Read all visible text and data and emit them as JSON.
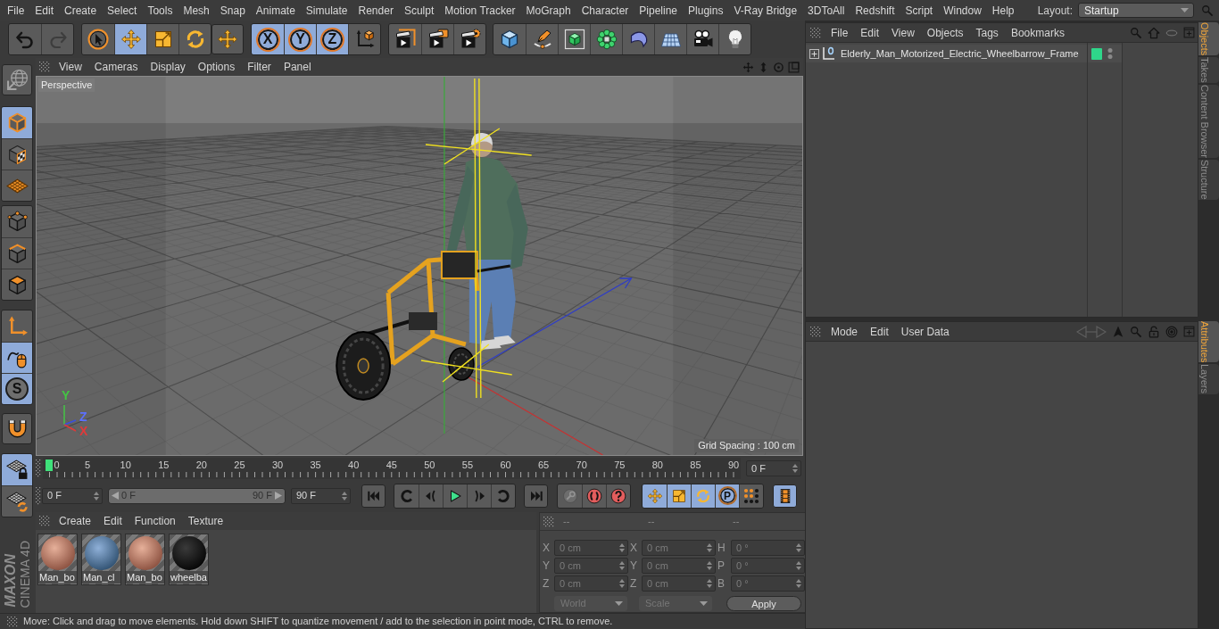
{
  "menu_bar": {
    "items": [
      "File",
      "Edit",
      "Create",
      "Select",
      "Tools",
      "Mesh",
      "Snap",
      "Animate",
      "Simulate",
      "Render",
      "Sculpt",
      "Motion Tracker",
      "MoGraph",
      "Character",
      "Pipeline",
      "Plugins",
      "V-Ray Bridge",
      "3DToAll",
      "Redshift",
      "Script",
      "Window",
      "Help"
    ],
    "layout_label": "Layout:",
    "layout_value": "Startup"
  },
  "toolbar": {
    "groups": [
      [
        {
          "kind": "icon",
          "selected": false,
          "disabled": false
        },
        {
          "kind": "icon",
          "selected": false,
          "disabled": true
        }
      ],
      [
        {
          "kind": "icon",
          "selected": false,
          "disabled": false
        },
        {
          "kind": "icon",
          "selected": true,
          "disabled": false
        },
        {
          "kind": "icon",
          "selected": false,
          "disabled": false
        },
        {
          "kind": "icon",
          "selected": false,
          "disabled": false
        }
      ],
      [
        {
          "kind": "icon",
          "selected": false,
          "disabled": false
        }
      ],
      [
        {
          "kind": "letter",
          "label": "X",
          "selected": true,
          "disabled": false
        },
        {
          "kind": "letter",
          "label": "Y",
          "selected": true,
          "disabled": false
        },
        {
          "kind": "letter",
          "label": "Z",
          "selected": true,
          "disabled": false
        },
        {
          "kind": "icon",
          "selected": false,
          "disabled": false
        }
      ],
      [
        {
          "kind": "icon",
          "selected": false,
          "disabled": false
        },
        {
          "kind": "icon",
          "selected": false,
          "disabled": false
        },
        {
          "kind": "icon",
          "selected": false,
          "disabled": false
        }
      ],
      [
        {
          "kind": "icon",
          "selected": false,
          "disabled": false
        },
        {
          "kind": "icon",
          "selected": false,
          "disabled": false
        },
        {
          "kind": "icon",
          "selected": false,
          "disabled": false
        },
        {
          "kind": "icon",
          "selected": false,
          "disabled": false
        },
        {
          "kind": "icon",
          "selected": false,
          "disabled": false
        },
        {
          "kind": "icon",
          "selected": false,
          "disabled": false
        },
        {
          "kind": "icon",
          "selected": false,
          "disabled": false
        },
        {
          "kind": "icon",
          "selected": false,
          "disabled": false
        }
      ]
    ]
  },
  "object_manager": {
    "menu": [
      "File",
      "Edit",
      "View",
      "Objects",
      "Tags",
      "Bookmarks"
    ],
    "objects": [
      {
        "name": "Elderly_Man_Motorized_Electric_Wheelbarrow_Frame",
        "expanded": false
      }
    ]
  },
  "side_tabs": {
    "upper": [
      {
        "label": "Objects",
        "selected": true
      },
      {
        "label": "Takes",
        "selected": false
      },
      {
        "label": "Content Browser",
        "selected": false
      },
      {
        "label": "Structure",
        "selected": false
      }
    ],
    "lower": [
      {
        "label": "Attributes",
        "selected": true
      },
      {
        "label": "Layers",
        "selected": false
      }
    ]
  },
  "mode_palette": {
    "groups": [
      [
        {
          "kind": "icon",
          "selected": false
        }
      ],
      [
        {
          "kind": "icon",
          "selected": true
        },
        {
          "kind": "icon",
          "selected": false
        },
        {
          "kind": "icon",
          "selected": false
        }
      ],
      [
        {
          "kind": "icon",
          "selected": false
        },
        {
          "kind": "icon",
          "selected": false
        },
        {
          "kind": "icon",
          "selected": false
        }
      ],
      [
        {
          "kind": "icon",
          "selected": false
        },
        {
          "kind": "icon",
          "selected": true
        },
        {
          "kind": "letter",
          "label": "S",
          "selected": true
        }
      ],
      [
        {
          "kind": "icon",
          "selected": false
        }
      ],
      [
        {
          "kind": "icon",
          "selected": true
        },
        {
          "kind": "icon",
          "selected": false
        }
      ]
    ]
  },
  "viewport": {
    "menu": [
      "View",
      "Cameras",
      "Display",
      "Options",
      "Filter",
      "Panel"
    ],
    "camera": "Perspective",
    "axis_labels": [
      {
        "label": "Y",
        "color": "#44c444"
      },
      {
        "label": "Z",
        "color": "#5c70ff"
      },
      {
        "label": "X",
        "color": "#e03a3a"
      }
    ],
    "grid_spacing": "Grid Spacing : 100 cm"
  },
  "attribute_manager": {
    "menu": [
      "Mode",
      "Edit",
      "User Data"
    ]
  },
  "timeline": {
    "frames": [
      "0",
      "5",
      "10",
      "15",
      "20",
      "25",
      "30",
      "35",
      "40",
      "45",
      "50",
      "55",
      "60",
      "65",
      "70",
      "75",
      "80",
      "85",
      "90"
    ],
    "level": 0,
    "current_frame": "0 F",
    "start_frame": "0 F",
    "range": {
      "start": "0 F",
      "end": "90 F",
      "level": 1
    },
    "end_frame": "90 F",
    "controls": [
      [
        {
          "kind": "icon",
          "selected": false
        }
      ],
      [
        {
          "kind": "icon",
          "selected": false
        },
        {
          "kind": "icon",
          "selected": false
        },
        {
          "kind": "icon",
          "selected": false
        },
        {
          "kind": "icon",
          "selected": false
        },
        {
          "kind": "icon",
          "selected": false
        }
      ],
      [
        {
          "kind": "icon",
          "selected": false
        }
      ],
      [
        {
          "kind": "icon",
          "selected": false,
          "disabled": true
        },
        {
          "kind": "icon",
          "selected": false,
          "disabled": false
        },
        {
          "kind": "icon",
          "selected": false,
          "disabled": false
        }
      ],
      [
        {
          "kind": "icon",
          "selected": true
        },
        {
          "kind": "icon",
          "selected": true
        },
        {
          "kind": "icon",
          "selected": true
        },
        {
          "kind": "letter",
          "label": "P",
          "selected": true
        },
        {
          "kind": "icon",
          "selected": false
        }
      ],
      [
        {
          "kind": "icon",
          "selected": true
        }
      ]
    ]
  },
  "material_manager": {
    "menu": [
      "Create",
      "Edit",
      "Function",
      "Texture"
    ],
    "materials": [
      {
        "label": "Man_bo",
        "kind": "skin"
      },
      {
        "label": "Man_cl",
        "kind": "fabric"
      },
      {
        "label": "Man_bo",
        "kind": "skin"
      },
      {
        "label": "wheelba",
        "kind": "dark"
      }
    ]
  },
  "coordinates": {
    "disabled": true,
    "headers": [
      "--",
      "--",
      "--"
    ],
    "rows": [
      [
        {
          "label": "X",
          "value": "0 cm"
        },
        {
          "label": "X",
          "value": "0 cm"
        },
        {
          "label": "H",
          "value": "0 °"
        }
      ],
      [
        {
          "label": "Y",
          "value": "0 cm"
        },
        {
          "label": "Y",
          "value": "0 cm"
        },
        {
          "label": "P",
          "value": "0 °"
        }
      ],
      [
        {
          "label": "Z",
          "value": "0 cm"
        },
        {
          "label": "Z",
          "value": "0 cm"
        },
        {
          "label": "B",
          "value": "0 °"
        }
      ]
    ],
    "mode": "World",
    "size_mode": "Scale",
    "apply": "Apply"
  },
  "logo": {
    "brand": "MAXON",
    "product": "CINEMA 4D"
  },
  "status_bar": {
    "text": "Move: Click and drag to move elements. Hold down SHIFT to quantize movement / add to the selection in point mode, CTRL to remove."
  }
}
